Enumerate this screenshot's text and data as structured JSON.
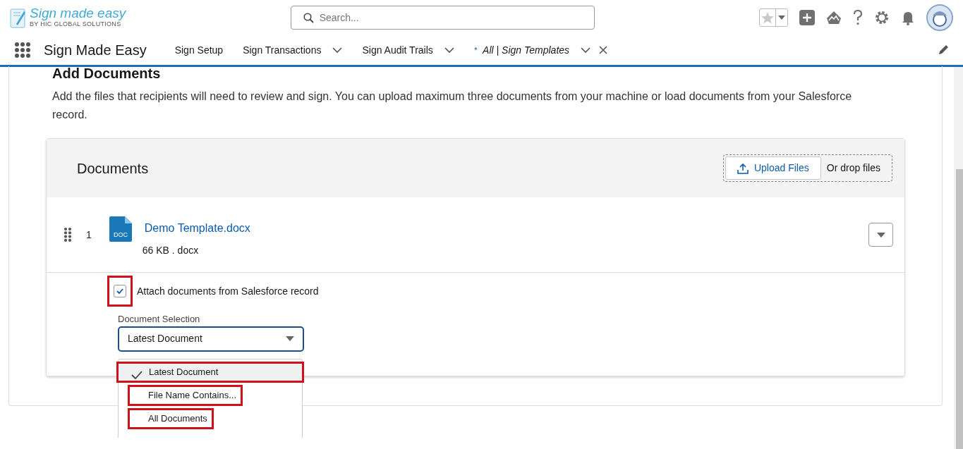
{
  "header": {
    "logo_title": "Sign made easy",
    "logo_subtitle": "BY HIC GLOBAL SOLUTIONS",
    "search_placeholder": "Search..."
  },
  "nav": {
    "app_name": "Sign Made Easy",
    "items": [
      {
        "label": "Sign Setup",
        "has_menu": false,
        "selected": false,
        "closable": false
      },
      {
        "label": "Sign Transactions",
        "has_menu": true,
        "selected": false,
        "closable": false
      },
      {
        "label": "Sign Audit Trails",
        "has_menu": true,
        "selected": false,
        "closable": false
      },
      {
        "prefix": "*",
        "label": "All | Sign Templates",
        "has_menu": true,
        "selected": true,
        "closable": true
      }
    ]
  },
  "section": {
    "title": "Add Documents",
    "description": "Add the files that recipients will need to review and sign. You can upload maximum three documents from your machine or load documents from your Salesforce record."
  },
  "documents": {
    "title": "Documents",
    "upload_button": "Upload Files",
    "drop_text": "Or drop files",
    "files": [
      {
        "index": "1",
        "icon_label": "DOC",
        "name": "Demo Template.docx",
        "meta": "66 KB . docx"
      }
    ],
    "attach": {
      "label": "Attach documents from Salesforce record",
      "checked": true,
      "highlighted": true
    },
    "selection": {
      "label": "Document Selection",
      "value": "Latest Document",
      "expanded": true,
      "options": [
        {
          "label": "Latest Document",
          "selected": true,
          "highlighted": true
        },
        {
          "label": "File Name Contains...",
          "selected": false,
          "highlighted": true
        },
        {
          "label": "All Documents",
          "selected": false,
          "highlighted": true
        }
      ]
    }
  }
}
